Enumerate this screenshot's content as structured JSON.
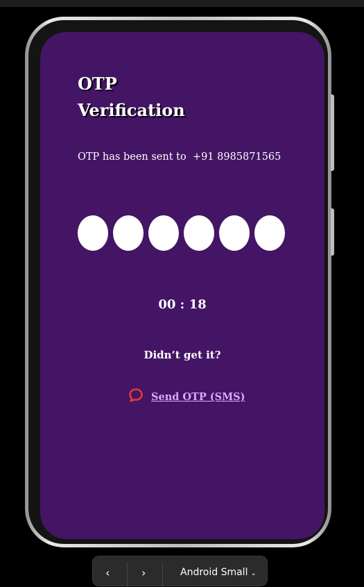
{
  "screen": {
    "title_line1": "OTP",
    "title_line2": "Verification",
    "sent_text": "OTP has been sent to  +91 8985871565",
    "otp_digits": [
      "",
      "",
      "",
      "",
      "",
      ""
    ],
    "timer": "00 : 18",
    "didnt_get": "Didn’t get it?",
    "send_link": "Send OTP (SMS)",
    "send_icon": "message-bubble-icon"
  },
  "toolbar": {
    "back_icon": "chevron-left-icon",
    "back_glyph": "‹",
    "forward_icon": "chevron-right-icon",
    "forward_glyph": "›",
    "device_label": "Android Small",
    "dropdown_glyph": "⌄"
  },
  "colors": {
    "screen_background": "#431564",
    "otp_box": "#ffffff",
    "link": "#d9a8ff",
    "sms_icon": "#e53935"
  }
}
